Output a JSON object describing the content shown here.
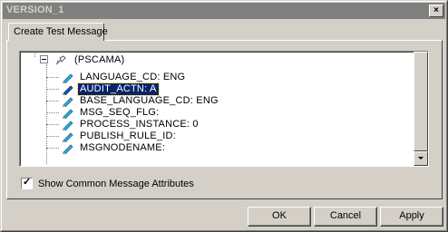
{
  "window": {
    "title": "VERSION_1",
    "close_glyph": "×"
  },
  "tabs": [
    {
      "label": "Create Test Message",
      "active": true
    }
  ],
  "tree": {
    "root": {
      "label": "(PSCAMA)",
      "icon": "message-node-icon",
      "expanded": true
    },
    "items": [
      {
        "label": "LANGUAGE_CD: ENG",
        "icon": "field-icon",
        "selected": false
      },
      {
        "label": "AUDIT_ACTN: A",
        "icon": "field-icon",
        "selected": true
      },
      {
        "label": "BASE_LANGUAGE_CD: ENG",
        "icon": "field-icon",
        "selected": false
      },
      {
        "label": "MSG_SEQ_FLG:",
        "icon": "field-icon",
        "selected": false
      },
      {
        "label": "PROCESS_INSTANCE: 0",
        "icon": "field-icon",
        "selected": false
      },
      {
        "label": "PUBLISH_RULE_ID:",
        "icon": "field-icon",
        "selected": false
      },
      {
        "label": "MSGNODENAME:",
        "icon": "field-icon",
        "selected": false
      }
    ]
  },
  "options": {
    "show_common_attrs_label": "Show Common Message Attributes",
    "show_common_attrs_checked": true,
    "check_glyph": "✓"
  },
  "buttons": {
    "ok": "OK",
    "cancel": "Cancel",
    "apply": "Apply"
  },
  "colors": {
    "selection_bg": "#0a246a",
    "field_icon": "#3aa8d8"
  }
}
